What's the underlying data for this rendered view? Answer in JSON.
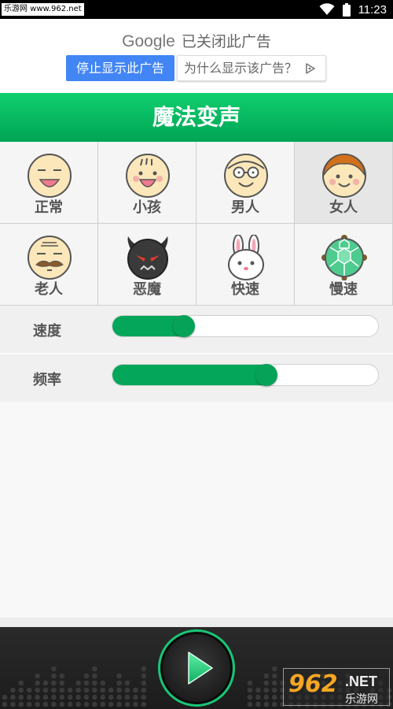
{
  "status_bar": {
    "watermark": "乐游网 www.962.net",
    "time": "11:23"
  },
  "ad": {
    "brand": "Google",
    "closed_text": "已关闭此广告",
    "stop_button": "停止显示此广告",
    "why_button": "为什么显示该广告？"
  },
  "title": "魔法变声",
  "voices": [
    {
      "label": "正常",
      "icon": "normal-face-icon",
      "selected": false
    },
    {
      "label": "小孩",
      "icon": "child-face-icon",
      "selected": false
    },
    {
      "label": "男人",
      "icon": "man-face-icon",
      "selected": false
    },
    {
      "label": "女人",
      "icon": "woman-face-icon",
      "selected": true
    },
    {
      "label": "老人",
      "icon": "old-man-face-icon",
      "selected": false
    },
    {
      "label": "恶魔",
      "icon": "devil-face-icon",
      "selected": false
    },
    {
      "label": "快速",
      "icon": "rabbit-icon",
      "selected": false
    },
    {
      "label": "慢速",
      "icon": "turtle-icon",
      "selected": false
    }
  ],
  "sliders": {
    "speed": {
      "label": "速度",
      "value": 0.27
    },
    "pitch": {
      "label": "频率",
      "value": 0.58
    }
  },
  "watermark_br": {
    "number": "962",
    "net": ".NET",
    "cn": "乐游网"
  },
  "colors": {
    "accent": "#04a65a",
    "ad_blue": "#4285f4",
    "play_ring": "#19c676"
  }
}
